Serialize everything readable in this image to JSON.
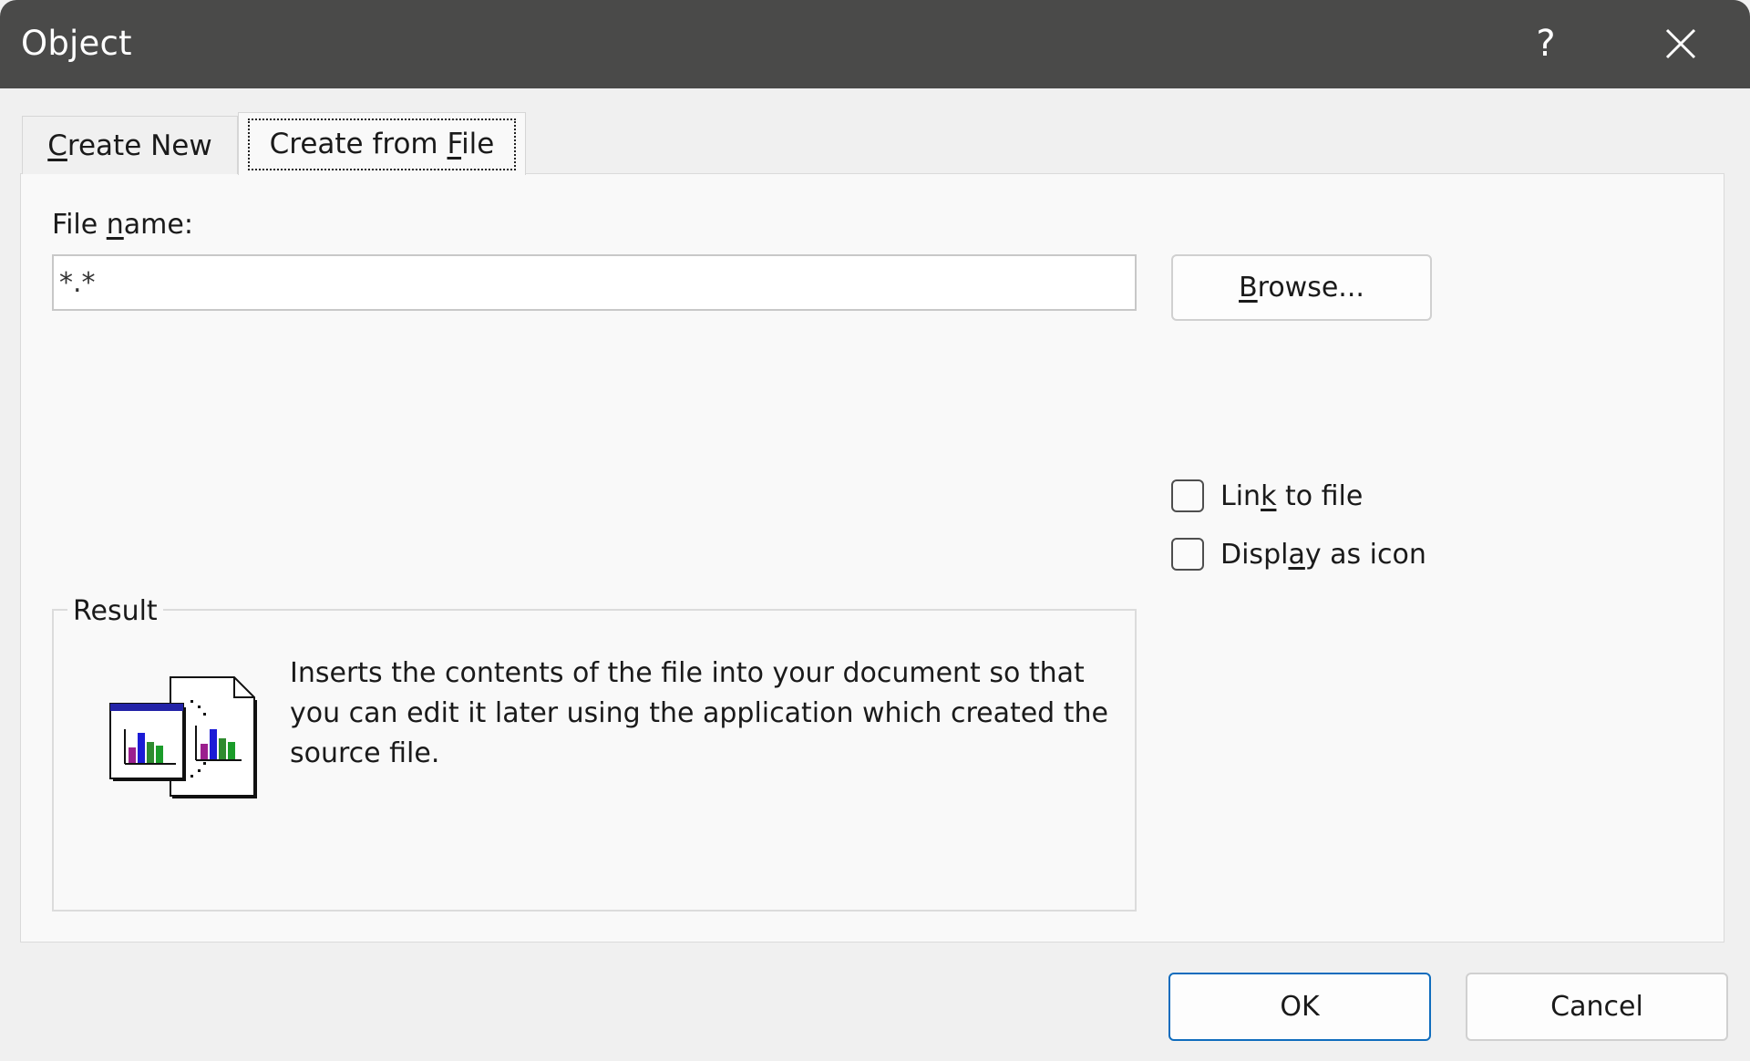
{
  "window": {
    "title": "Object",
    "help_label": "?",
    "close_icon": "close-icon"
  },
  "tabs": [
    {
      "label": "Create New",
      "mnemonic": "C",
      "rest": "reate New",
      "selected": false
    },
    {
      "label": "Create from File",
      "before": "Create from ",
      "mnemonic": "F",
      "rest": "ile",
      "selected": true
    }
  ],
  "form": {
    "filename_label_before": "File ",
    "filename_label_mnemonic": "n",
    "filename_label_after": "ame:",
    "filename_value": "*.*",
    "browse_mnemonic": "B",
    "browse_rest": "rowse...",
    "link_before": "Lin",
    "link_mnemonic": "k",
    "link_after": " to file",
    "link_checked": false,
    "icon_before": "Displ",
    "icon_mnemonic": "a",
    "icon_after": "y as icon",
    "icon_checked": false
  },
  "result": {
    "legend": "Result",
    "description": "Inserts the contents of the file into your document so that you can edit it later using the application which created the source file.",
    "icon": "embedded-chart-document-icon"
  },
  "footer": {
    "ok_label": "OK",
    "cancel_label": "Cancel"
  },
  "colors": {
    "titlebar": "#4a4a49",
    "accent": "#0f6cbd",
    "panel": "#f9f9f9"
  }
}
